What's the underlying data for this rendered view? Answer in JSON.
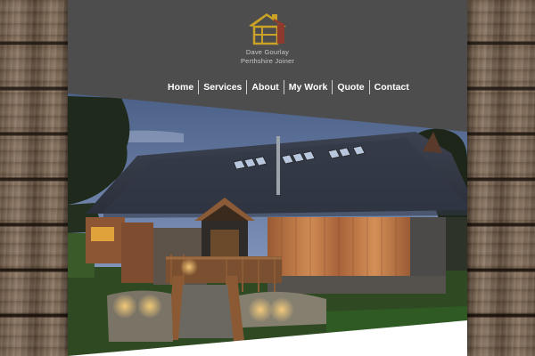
{
  "site": {
    "brand_name": "Dave Gourlay",
    "brand_tagline": "Perthshire Joiner"
  },
  "nav": {
    "items": [
      "Home",
      "Services",
      "About",
      "My Work",
      "Quote",
      "Contact"
    ]
  },
  "colors": {
    "header_bg": "#4d4d4d",
    "logo_gold": "#c9a227",
    "logo_red": "#8e3b2d",
    "nav_text": "#ffffff"
  },
  "icons": {
    "logo": "house-logo-icon"
  }
}
